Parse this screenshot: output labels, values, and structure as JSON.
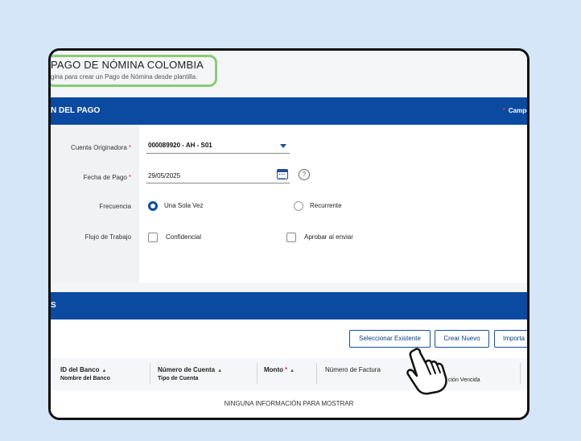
{
  "header": {
    "title": "PAGO DE NÓMINA COLOMBIA",
    "subtitle": "gina para crear un Pago de Nómina desde plantilla."
  },
  "section1": {
    "title": "N DEL PAGO",
    "required_note": "Campo",
    "required_mark": "*"
  },
  "form": {
    "cuenta": {
      "label": "Cuenta Originadora",
      "value": "000089920 - AH - S01"
    },
    "fecha": {
      "label": "Fecha de Pago",
      "value": "29/05/2025"
    },
    "frecuencia": {
      "label": "Frecuencia",
      "option1": "Una Sola Vez",
      "option2": "Recurrente"
    },
    "flujo": {
      "label": "Flujo de Trabajo",
      "option1": "Confidencial",
      "option2": "Aprobar al enviar"
    },
    "required_mark": "*",
    "help_glyph": "?"
  },
  "section2": {
    "title": "S"
  },
  "buttons": {
    "select_existing": "Seleccionar Existente",
    "create_new": "Crear Nuevo",
    "import": "Importa"
  },
  "table": {
    "col1": {
      "title": "ID del Banco",
      "sub": "Nombre del Banco"
    },
    "col2": {
      "title": "Número de Cuenta",
      "sub": "Tipo de Cuenta"
    },
    "col3": {
      "title": "Monto",
      "required": "*"
    },
    "col4": {
      "title": "Número de Factura"
    },
    "col5": {
      "sub": "ción Vencida"
    },
    "empty_message": "NINGUNA INFORMACIÓN PARA MOSTRAR"
  },
  "colors": {
    "primary": "#0a4aa1",
    "highlight": "#86cd73",
    "required": "#d9363e",
    "background": "#d4e6f7"
  }
}
